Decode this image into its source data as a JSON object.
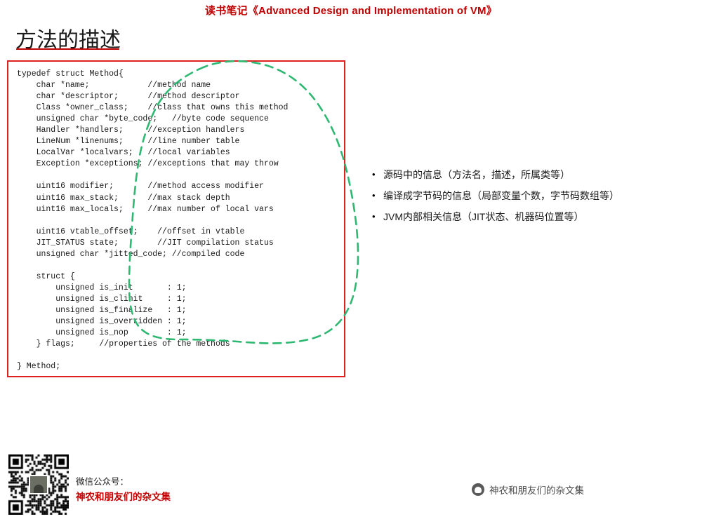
{
  "header": {
    "title": "读书笔记《Advanced Design and Implementation of VM》"
  },
  "slide": {
    "title": "方法的描述"
  },
  "code": {
    "language": "c",
    "text": "typedef struct Method{\n    char *name;            //method name\n    char *descriptor;      //method descriptor\n    Class *owner_class;    //class that owns this method\n    unsigned char *byte_code;   //byte code sequence\n    Handler *handlers;     //exception handlers\n    LineNum *linenums;     //line number table\n    LocalVar *localvars;   //local variables\n    Exception *exceptions; //exceptions that may throw\n\n    uint16 modifier;       //method access modifier\n    uint16 max_stack;      //max stack depth\n    uint16 max_locals;     //max number of local vars\n\n    uint16 vtable_offset;    //offset in vtable\n    JIT_STATUS state;        //JIT compilation status\n    unsigned char *jitted_code; //compiled code\n\n    struct {\n        unsigned is_init       : 1;\n        unsigned is_clinit     : 1;\n        unsigned is_finalize   : 1;\n        unsigned is_overridden : 1;\n        unsigned is_nop        : 1;\n    } flags;     //properties of the methods\n\n} Method;"
  },
  "bullets": [
    {
      "marker": "•",
      "text": "源码中的信息（方法名，描述，所属类等）"
    },
    {
      "marker": "•",
      "text": "编译成字节码的信息（局部变量个数，字节码数组等）"
    },
    {
      "marker": "•",
      "text": "JVM内部相关信息（JIT状态、机器码位置等）"
    }
  ],
  "annotation": {
    "shape": "hand-drawn-dashed-loop",
    "color": "#2eb872"
  },
  "footer": {
    "wechat_label": "微信公众号：",
    "wechat_name": "神农和朋友们的杂文集",
    "brand_text": "神农和朋友们的杂文集"
  },
  "colors": {
    "header_red": "#c00000",
    "code_border": "#e02020",
    "annotation_green": "#2eb872"
  }
}
